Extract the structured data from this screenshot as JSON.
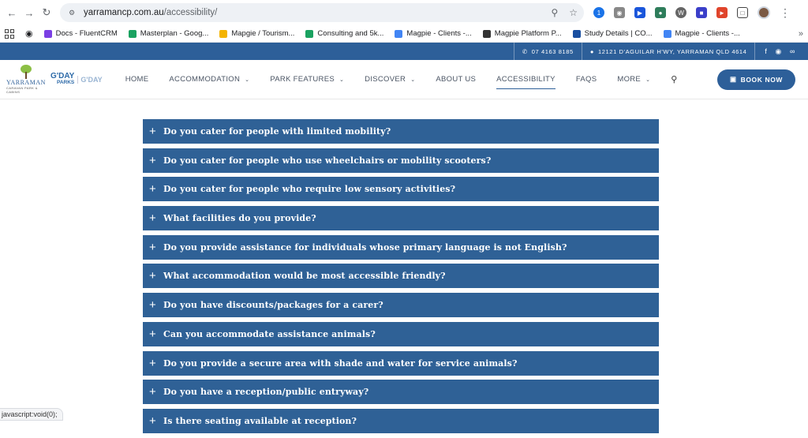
{
  "browser": {
    "url_host": "yarramancp.com.au",
    "url_path": "/accessibility/",
    "bookmarks": [
      {
        "label": "Docs - FluentCRM",
        "color": "#7b3fe4"
      },
      {
        "label": "Masterplan - Goog...",
        "color": "#1aa260"
      },
      {
        "label": "Mapgie / Tourism...",
        "color": "#f4b400"
      },
      {
        "label": "Consulting and 5k...",
        "color": "#1aa260"
      },
      {
        "label": "Magpie - Clients -...",
        "color": "#4285f4"
      },
      {
        "label": "Magpie Platform P...",
        "color": "#333333"
      },
      {
        "label": "Study Details | CO...",
        "color": "#1a4fa0"
      },
      {
        "label": "Magpie - Clients -...",
        "color": "#4285f4"
      }
    ]
  },
  "infobar": {
    "phone": "07 4163 8185",
    "address": "12121 D'AGUILAR H'WY, YARRAMAN QLD 4614"
  },
  "logos": {
    "park_name": "YARRAMAN",
    "park_sub": "CARAVAN PARK & CABINS",
    "gday_1": "G'DAY",
    "gday_2": "PARKS",
    "gday_3": "G'DAY"
  },
  "nav": {
    "home": "HOME",
    "accommodation": "ACCOMMODATION",
    "park_features": "PARK FEATURES",
    "discover": "DISCOVER",
    "about_us": "ABOUT US",
    "accessibility": "ACCESSIBILITY",
    "faqs": "FAQS",
    "more": "MORE",
    "book_now": "BOOK NOW"
  },
  "faq": [
    "Do you cater for people with limited mobility?",
    "Do you cater for people who use wheelchairs or mobility scooters?",
    "Do you cater for people who require low sensory activities?",
    "What facilities do you provide?",
    "Do you provide assistance for individuals whose primary language is not English?",
    "What accommodation would be most accessible friendly?",
    "Do you have discounts/packages for a carer?",
    "Can you accommodate assistance animals?",
    "Do you provide a secure area with shade and water for service animals?",
    "Do you have a reception/public entryway?",
    "Is there seating available at reception?"
  ],
  "status_bar": "javascript:void(0);"
}
